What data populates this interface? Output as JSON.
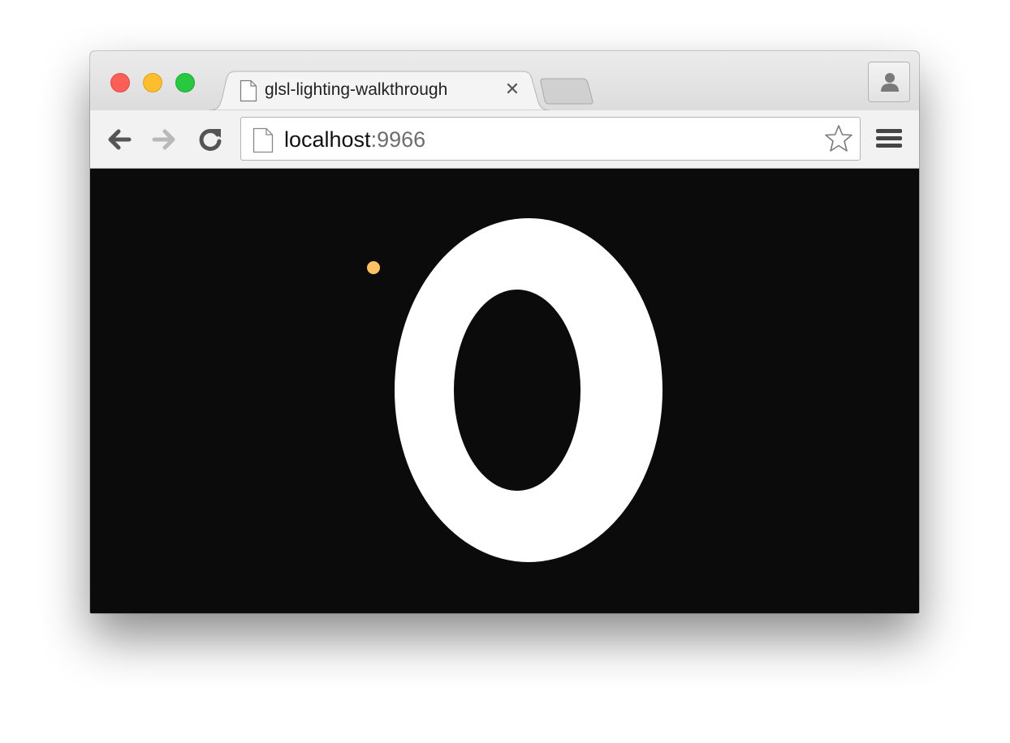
{
  "window": {
    "traffic_lights": {
      "close_color": "#fc5f57",
      "minimize_color": "#fdbd2e",
      "maximize_color": "#28c840"
    }
  },
  "tabs": [
    {
      "title": "glsl-lighting-walkthrough",
      "icon": "document-icon",
      "close_glyph": "✕"
    }
  ],
  "toolbar": {
    "back_icon": "back-arrow-icon",
    "forward_icon": "forward-arrow-icon",
    "reload_icon": "reload-icon",
    "menu_icon": "hamburger-menu-icon",
    "profile_icon": "profile-icon"
  },
  "omnibox": {
    "host": "localhost",
    "port": ":9966",
    "bookmark_icon": "star-icon"
  },
  "canvas": {
    "background_color": "#0b0b0b",
    "shape_color": "#ffffff",
    "light_color": "#ffc163"
  }
}
